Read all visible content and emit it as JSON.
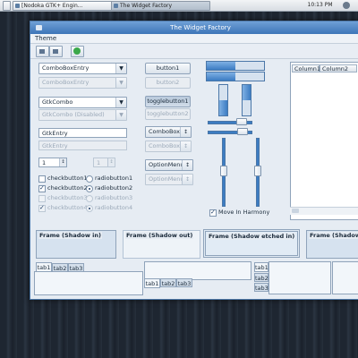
{
  "taskbar": {
    "tasks": [
      "[Nodoka GTK+ Engin...",
      "The Widget Factory"
    ],
    "clock": "10:13 PM"
  },
  "window": {
    "title": "The Widget Factory",
    "menu": [
      "Theme"
    ]
  },
  "left_column": {
    "combobox_entry": "ComboBoxEntry",
    "combobox_entry_disabled": "ComboBoxEntry",
    "gtkcombo": "GtkCombo",
    "gtkcombo_disabled": "GtkCombo (Disabled)",
    "gtkentry": "GtkEntry",
    "gtkentry_disabled": "GtkEntry",
    "spin_value": "1",
    "spin_disabled_value": "1",
    "checks": [
      {
        "label": "checkbutton1",
        "checked": false,
        "disabled": false
      },
      {
        "label": "checkbutton2",
        "checked": true,
        "disabled": false
      },
      {
        "label": "checkbutton3",
        "checked": false,
        "disabled": true
      },
      {
        "label": "checkbutton4",
        "checked": true,
        "disabled": true
      }
    ],
    "radios": [
      {
        "label": "radiobutton1",
        "selected": false,
        "disabled": false
      },
      {
        "label": "radiobutton2",
        "selected": true,
        "disabled": false
      },
      {
        "label": "radiobutton3",
        "selected": false,
        "disabled": true
      },
      {
        "label": "radiobutton4",
        "selected": true,
        "disabled": true
      }
    ]
  },
  "middle_column": {
    "button1": "button1",
    "button2": "button2",
    "togglebutton1": "togglebutton1",
    "togglebutton2": "togglebutton2",
    "combobox": "ComboBox",
    "combobox_disabled": "ComboBox",
    "optionmenu": "OptionMenu",
    "optionmenu_disabled": "OptionMenu"
  },
  "progress": {
    "horizontal_1": 0.5,
    "horizontal_2": 0.5,
    "vertical_1": 0.5,
    "vertical_2": 0.5
  },
  "scales": {
    "harmony_label": "Move In Harmony",
    "harmony_checked": true
  },
  "tree": {
    "columns": [
      "Column1",
      "Column2"
    ]
  },
  "frames": [
    "Frame (Shadow in)",
    "Frame (Shadow out)",
    "Frame (Shadow etched in)",
    "Frame (Shadow etc"
  ],
  "notebooks": {
    "tabs": [
      "tab1",
      "tab2",
      "tab3"
    ]
  },
  "colors": {
    "accent": "#3c7cc2",
    "titlebar": "#4f86c6",
    "window_bg": "#e6ecf3"
  }
}
